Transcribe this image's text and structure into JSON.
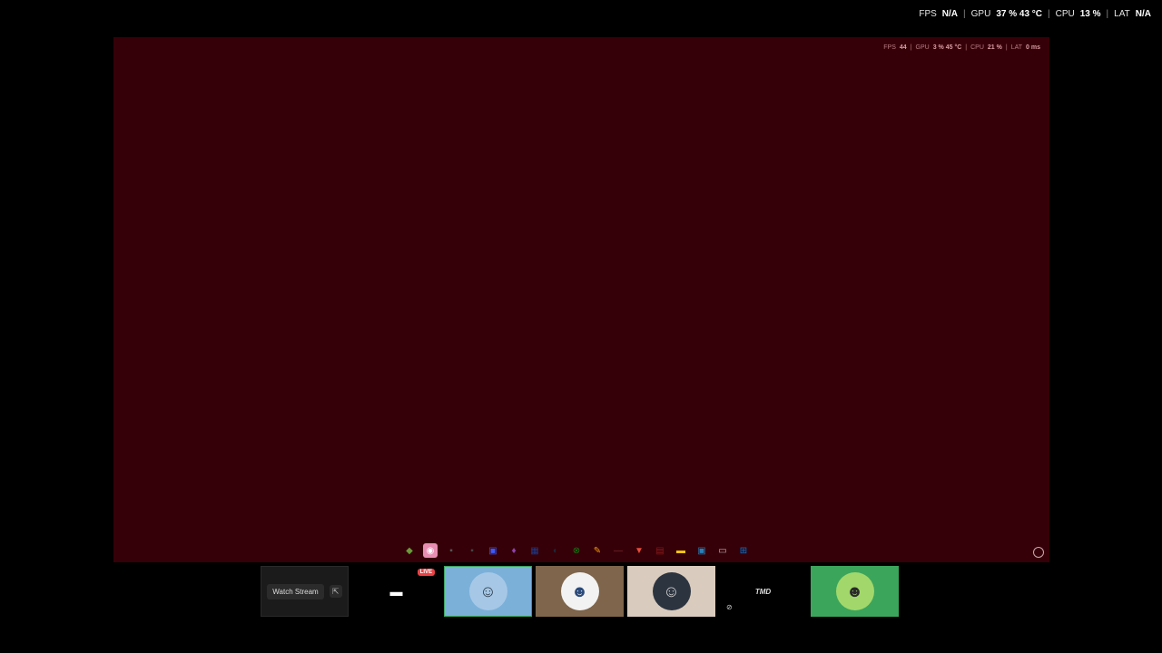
{
  "overlay_top": {
    "fps_label": "FPS",
    "fps_value": "N/A",
    "gpu_label": "GPU",
    "gpu_value": "37 % 43 °C",
    "cpu_label": "CPU",
    "cpu_value": "13 %",
    "lat_label": "LAT",
    "lat_value": "N/A"
  },
  "stream": {
    "overlay": {
      "fps_label": "FPS",
      "fps_value": "44",
      "gpu_label": "GPU",
      "gpu_value": "3 % 45 °C",
      "cpu_label": "CPU",
      "cpu_value": "21 %",
      "lat_label": "LAT",
      "lat_value": "0 ms"
    },
    "background_color": "#360008",
    "taskbar_icons": [
      {
        "name": "app-icon-1",
        "glyph": "◆",
        "color": "#6a9a3a"
      },
      {
        "name": "discord-icon",
        "glyph": "◉",
        "color": "#5865f2",
        "active": true
      },
      {
        "name": "app-icon-3",
        "glyph": "▪",
        "color": "#555"
      },
      {
        "name": "app-icon-4",
        "glyph": "▪",
        "color": "#444"
      },
      {
        "name": "app-icon-5",
        "glyph": "▣",
        "color": "#3d5afe"
      },
      {
        "name": "app-icon-6",
        "glyph": "♦",
        "color": "#8e44ad"
      },
      {
        "name": "app-icon-7",
        "glyph": "▦",
        "color": "#1e3a8a"
      },
      {
        "name": "steam-icon",
        "glyph": "◐",
        "color": "#1b2838"
      },
      {
        "name": "xbox-icon",
        "glyph": "⊗",
        "color": "#107c10"
      },
      {
        "name": "app-icon-10",
        "glyph": "✎",
        "color": "#f39c12"
      },
      {
        "name": "app-icon-11",
        "glyph": "—",
        "color": "#7a2a2a"
      },
      {
        "name": "brave-icon",
        "glyph": "▼",
        "color": "#e74c3c"
      },
      {
        "name": "app-icon-13",
        "glyph": "▤",
        "color": "#8b1a1a"
      },
      {
        "name": "folder-icon",
        "glyph": "▬",
        "color": "#f1c40f"
      },
      {
        "name": "app-icon-15",
        "glyph": "▣",
        "color": "#2980b9"
      },
      {
        "name": "app-icon-16",
        "glyph": "▭",
        "color": "#bbb"
      },
      {
        "name": "windows-icon",
        "glyph": "⊞",
        "color": "#0078d4"
      }
    ]
  },
  "tiles": {
    "watch_label": "Watch Stream",
    "live_label": "LIVE",
    "tmd_label": "TMD"
  }
}
